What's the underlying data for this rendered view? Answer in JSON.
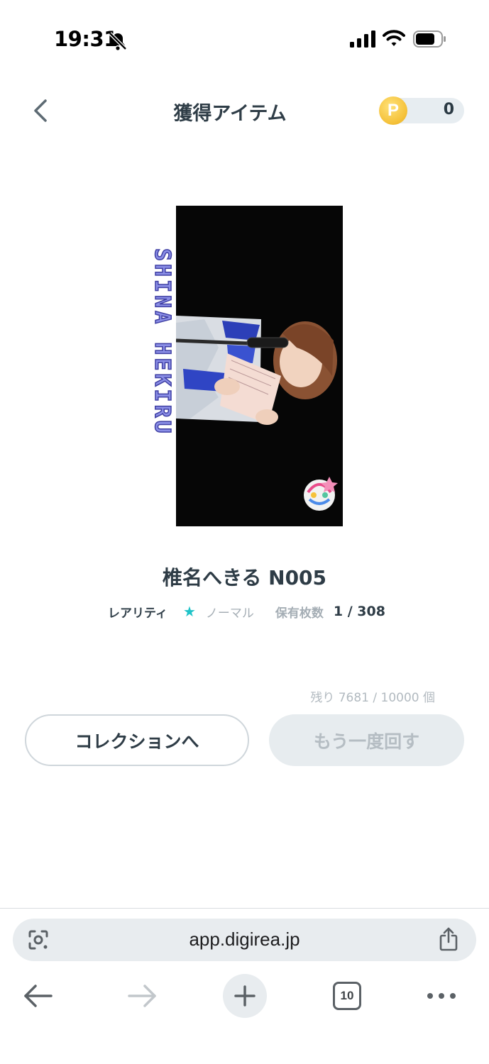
{
  "status_bar": {
    "time": "19:31",
    "icons": [
      "bell-slash-icon",
      "cellular-signal-icon",
      "wifi-icon",
      "battery-icon"
    ]
  },
  "header": {
    "title": "獲得アイテム",
    "points_badge": "P",
    "points_value": "0"
  },
  "card": {
    "side_text": "SHINA HEKIRU",
    "logo_icon": "event-logo-icon"
  },
  "item": {
    "title": "椎名へきる N005",
    "rarity_label": "レアリティ",
    "rarity_star": "★",
    "rarity_value": "ノーマル",
    "owned_label": "保有枚数",
    "owned_value": "1 / 308",
    "remaining": "残り 7681 / 10000 個"
  },
  "actions": {
    "collection_label": "コレクションへ",
    "spin_again_label": "もう一度回す"
  },
  "browser": {
    "url": "app.digirea.jp",
    "tab_count": "10"
  },
  "colors": {
    "accent_star": "#1fc3c8",
    "coin": "#f5c23b",
    "card_text": "#8a8ee6"
  }
}
